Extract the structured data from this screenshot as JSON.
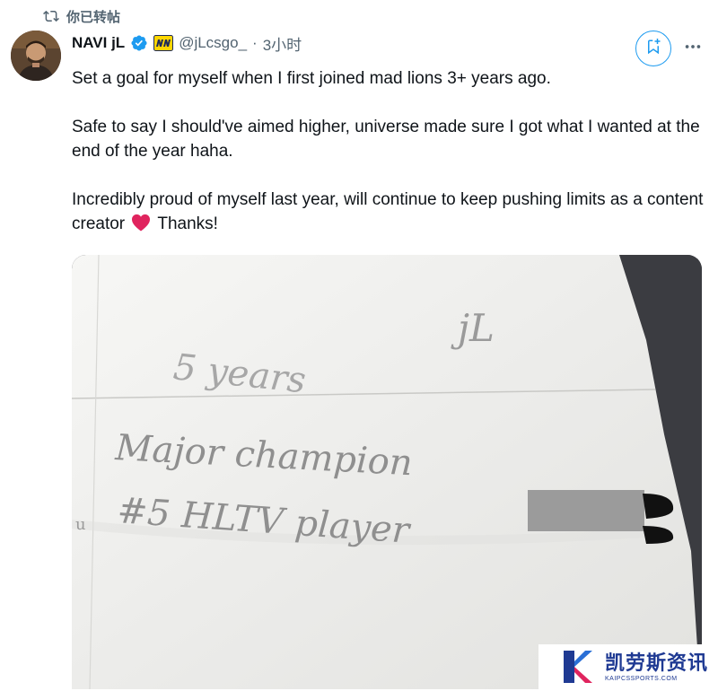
{
  "repost": {
    "label": "你已转帖",
    "icon": "repost-icon"
  },
  "author": {
    "display_name": "NAVI jL",
    "handle": "@jLcsgo_",
    "separator": "·",
    "time": "3小时",
    "verified_icon": "verified-badge-icon",
    "affiliate_icon": "navi-team-badge-icon"
  },
  "actions": {
    "bookmark_icon": "bookmark-icon",
    "more_icon": "more-options-icon"
  },
  "tweet": {
    "paragraph_1": "Set a goal for myself when I first joined mad lions 3+ years ago.",
    "paragraph_2": "Safe to say I should've aimed higher, universe made sure I got what I wanted at the end of the year haha.",
    "paragraph_3_before": "Incredibly proud of myself last year, will continue to keep pushing limits as a content creator",
    "paragraph_3_after": "Thanks!",
    "emoji": "red-heart"
  },
  "media": {
    "handwriting": {
      "signature": "jL",
      "line_1": "5 years",
      "line_2": "Major champion",
      "line_3": "#5 HLTV player"
    }
  },
  "watermark": {
    "main": "凯劳斯资讯",
    "sub": "KAIPCSSPORTS.COM"
  },
  "colors": {
    "accent": "#1d9bf0",
    "secondary_text": "#536471",
    "primary_text": "#0f1419",
    "heart": "#e0245e",
    "watermark": "#1f3a93"
  }
}
